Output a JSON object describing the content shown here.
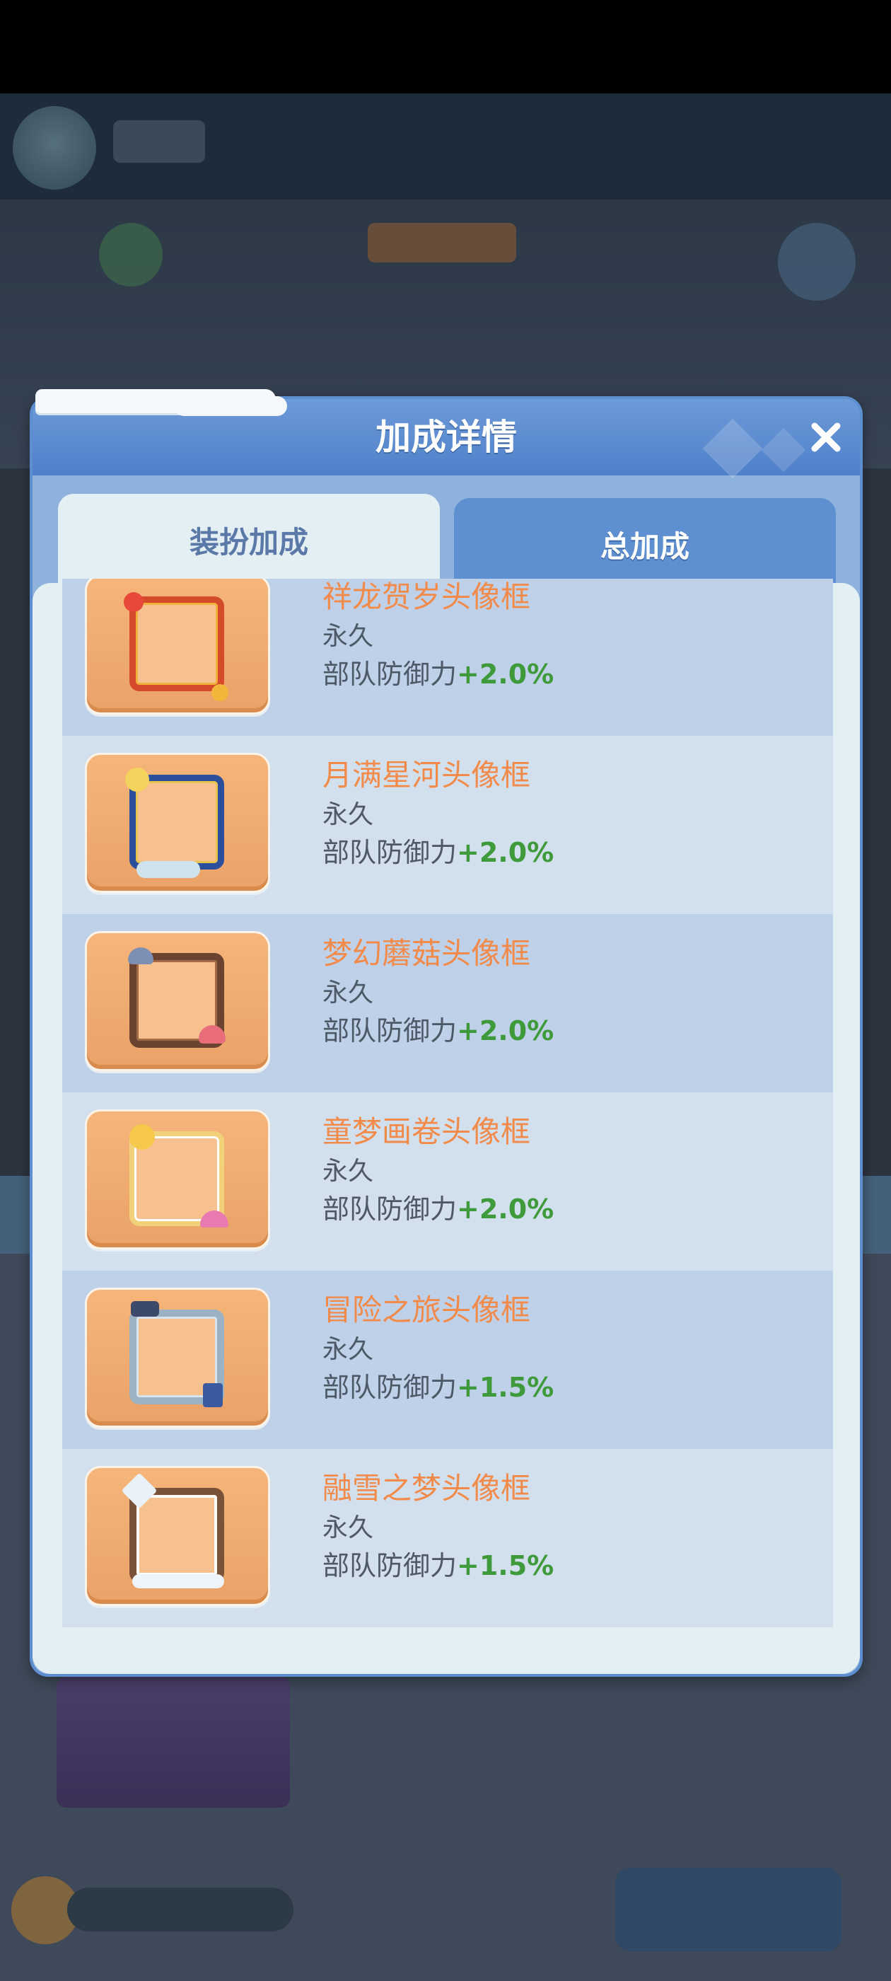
{
  "modal": {
    "title": "加成详情",
    "close_icon": "close-icon",
    "tabs": [
      {
        "label": "装扮加成",
        "active": true
      },
      {
        "label": "总加成",
        "active": false
      }
    ]
  },
  "items": [
    {
      "name": "祥龙贺岁头像框",
      "duration": "永久",
      "effect_label": "部队防御力",
      "bonus": "+2.0%",
      "icon": "dragon-frame-icon"
    },
    {
      "name": "月满星河头像框",
      "duration": "永久",
      "effect_label": "部队防御力",
      "bonus": "+2.0%",
      "icon": "starry-night-frame-icon"
    },
    {
      "name": "梦幻蘑菇头像框",
      "duration": "永久",
      "effect_label": "部队防御力",
      "bonus": "+2.0%",
      "icon": "mushroom-frame-icon"
    },
    {
      "name": "童梦画卷头像框",
      "duration": "永久",
      "effect_label": "部队防御力",
      "bonus": "+2.0%",
      "icon": "sun-rainbow-frame-icon"
    },
    {
      "name": "冒险之旅头像框",
      "duration": "永久",
      "effect_label": "部队防御力",
      "bonus": "+1.5%",
      "icon": "adventure-frame-icon"
    },
    {
      "name": "融雪之梦头像框",
      "duration": "永久",
      "effect_label": "部队防御力",
      "bonus": "+1.5%",
      "icon": "snow-frame-icon"
    }
  ],
  "colors": {
    "header": "#5d8fd1",
    "item_name": "#f28a4a",
    "bonus": "#3e9a3a",
    "text": "#4d5966"
  }
}
